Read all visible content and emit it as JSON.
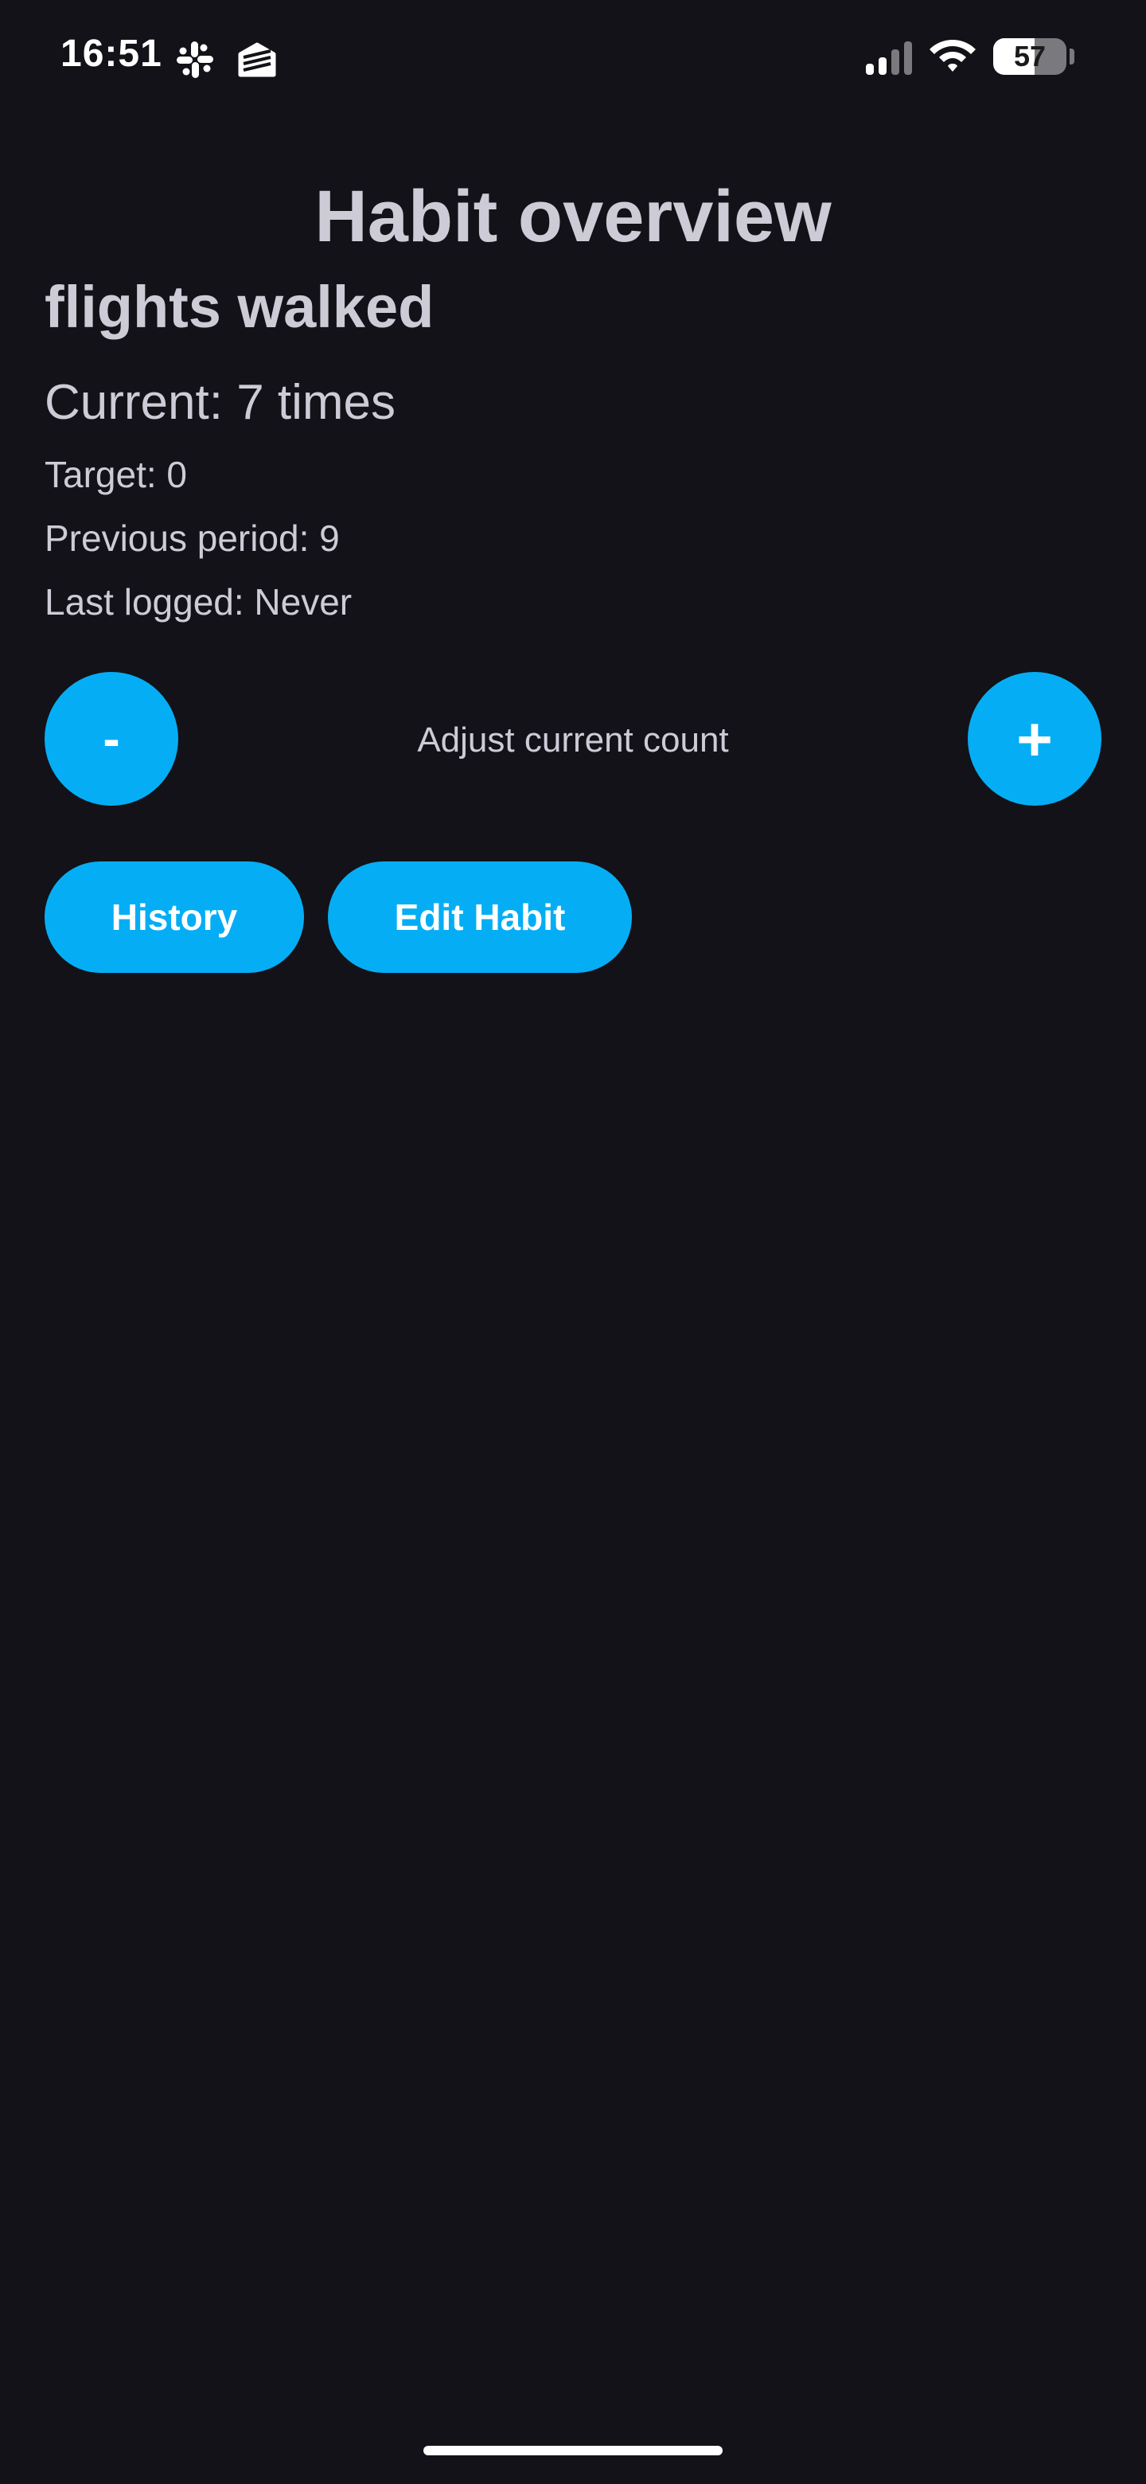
{
  "status_bar": {
    "time": "16:51",
    "battery_level": "57",
    "battery_fraction": 0.57,
    "icons": [
      "slack-icon",
      "mail-icon",
      "signal-icon",
      "wifi-icon",
      "battery-icon"
    ]
  },
  "page": {
    "title": "Habit overview"
  },
  "habit": {
    "name": "flights walked",
    "current": "Current: 7 times",
    "target": "Target: 0",
    "previous_period": "Previous period: 9",
    "last_logged": "Last logged: Never"
  },
  "adjust": {
    "minus_label": "-",
    "plus_label": "+",
    "label": "Adjust current count"
  },
  "actions": {
    "history_label": "History",
    "edit_label": "Edit Habit"
  },
  "colors": {
    "background": "#131218",
    "accent": "#05aef4",
    "text": "#cdcbd6"
  }
}
